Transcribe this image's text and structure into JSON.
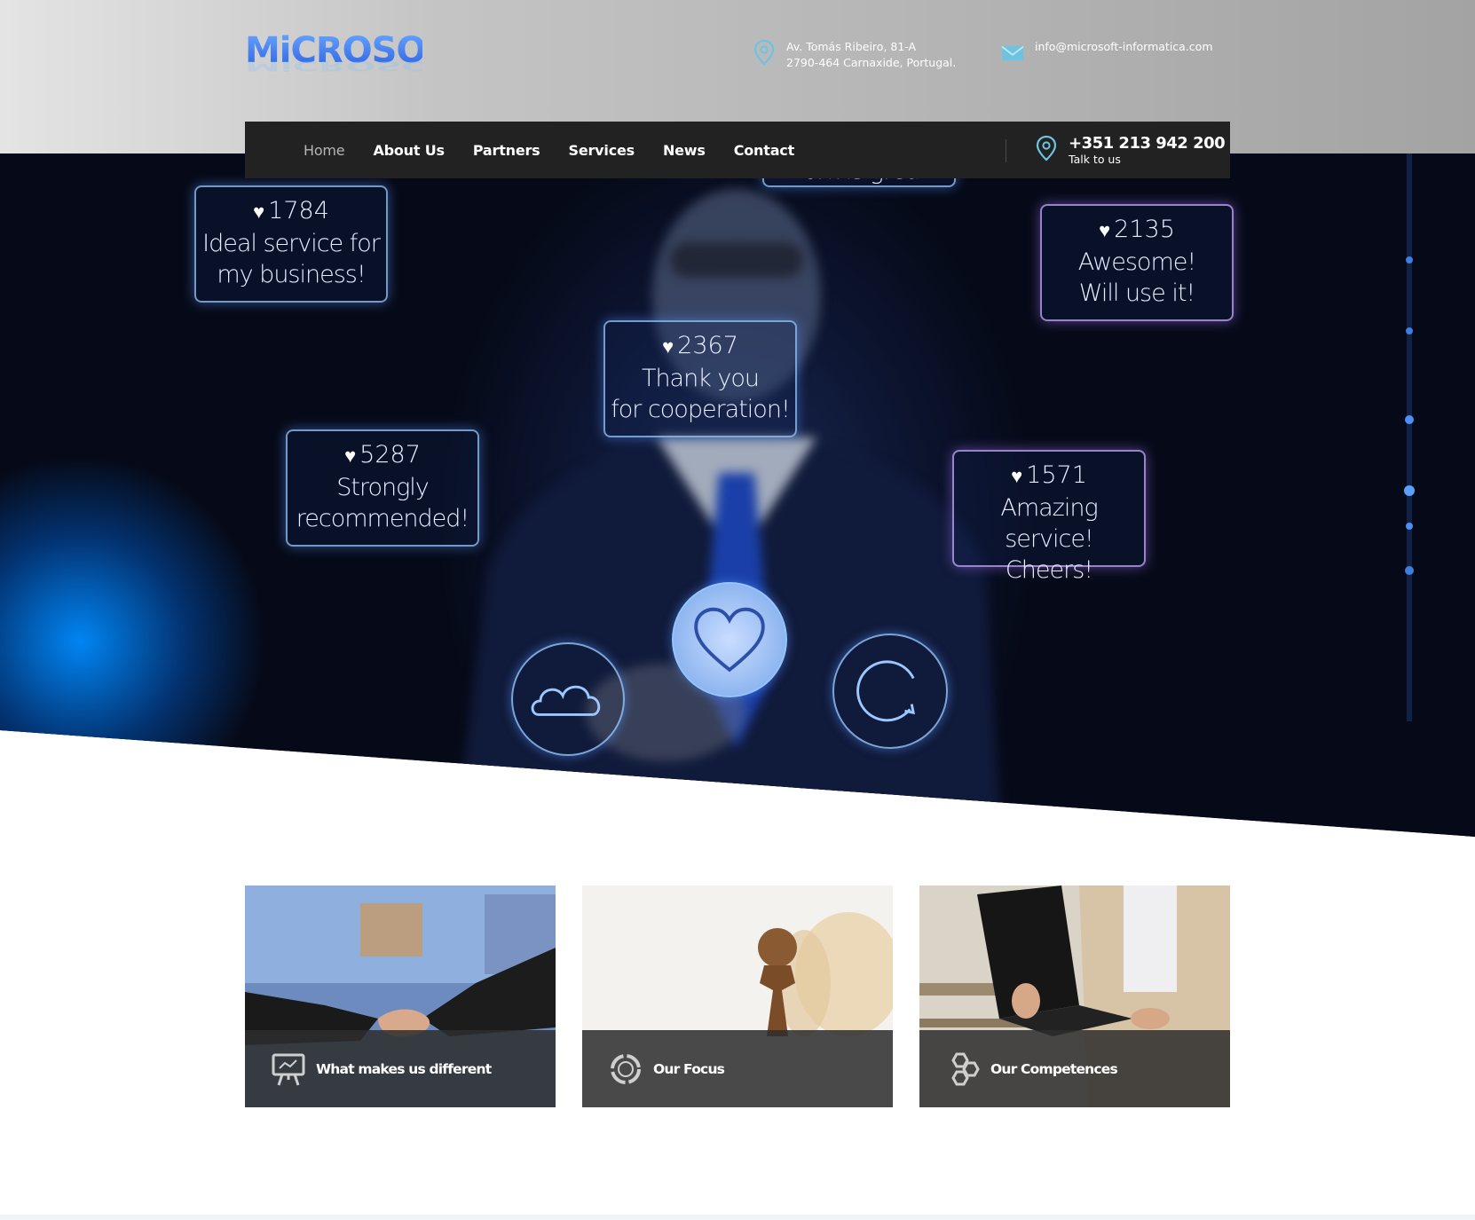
{
  "brand": {
    "logo_text": "MiCROSOFt"
  },
  "header": {
    "address_line1": "Av. Tomás Ribeiro, 81-A",
    "address_line2": "2790-464 Carnaxide, Portugal.",
    "email": "info@microsoft-informatica.com",
    "address_icon": "location-pin-icon",
    "email_icon": "envelope-icon"
  },
  "nav": {
    "items": [
      {
        "label": "Home",
        "active": true
      },
      {
        "label": "About Us"
      },
      {
        "label": "Partners"
      },
      {
        "label": "Services"
      },
      {
        "label": "News"
      },
      {
        "label": "Contact"
      }
    ],
    "phone": "+351 213 942 200",
    "phone_sub": "Talk to us",
    "phone_icon": "location-pin-icon"
  },
  "hero": {
    "bubbles": [
      {
        "count": "1784",
        "text1": "Ideal service for",
        "text2": "my business!"
      },
      {
        "count": "",
        "text1": "Work is great!",
        "text2": ""
      },
      {
        "count": "2135",
        "text1": "Awesome!",
        "text2": "Will use it!"
      },
      {
        "count": "2367",
        "text1": "Thank you",
        "text2": "for cooperation!"
      },
      {
        "count": "5287",
        "text1": "Strongly",
        "text2": "recommended!"
      },
      {
        "count": "1571",
        "text1": "Amazing service!",
        "text2": "Cheers!"
      }
    ],
    "icons": [
      "cloud-icon",
      "heart-icon",
      "refresh-icon"
    ]
  },
  "cards": [
    {
      "label": "What makes us different",
      "icon": "presentation-board-icon"
    },
    {
      "label": "Our Focus",
      "icon": "circular-chart-icon"
    },
    {
      "label": "Our Competences",
      "icon": "hexagons-icon"
    }
  ],
  "colors": {
    "accent": "#3f7de8",
    "nav_bg": "#222222",
    "icon_blue": "#6ec3e0"
  }
}
